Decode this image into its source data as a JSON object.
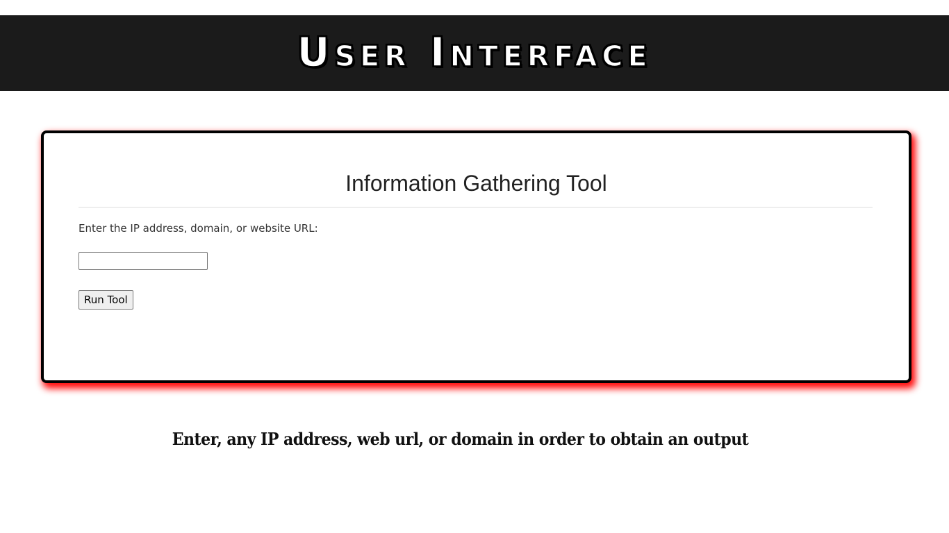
{
  "banner": {
    "title": "User Interface"
  },
  "card": {
    "title": "Information Gathering Tool",
    "field_label": "Enter the IP address, domain, or website URL:",
    "input_value": "",
    "input_placeholder": "",
    "run_button_label": "Run Tool"
  },
  "caption": {
    "text": "Enter, any IP address, web url, or domain in order to obtain an output"
  },
  "colors": {
    "banner_background": "#1b1b1b",
    "card_border": "#000000",
    "card_shadow": "#ff0000"
  }
}
